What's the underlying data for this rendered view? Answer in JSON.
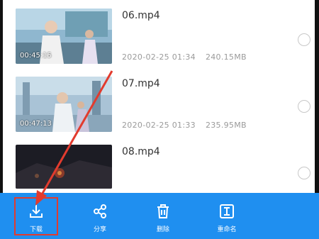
{
  "files": [
    {
      "name": "06.mp4",
      "duration": "00:45:15",
      "date": "2020-02-25 01:34",
      "size": "240.15MB"
    },
    {
      "name": "07.mp4",
      "duration": "00:47:13",
      "date": "2020-02-25 01:33",
      "size": "235.95MB"
    },
    {
      "name": "08.mp4",
      "duration": "",
      "date": "",
      "size": ""
    }
  ],
  "toolbar": {
    "download_label": "下载",
    "share_label": "分享",
    "delete_label": "删除",
    "rename_label": "重命名"
  },
  "colors": {
    "toolbar_bg": "#1f8ff0",
    "annotation": "#e23b2e"
  }
}
